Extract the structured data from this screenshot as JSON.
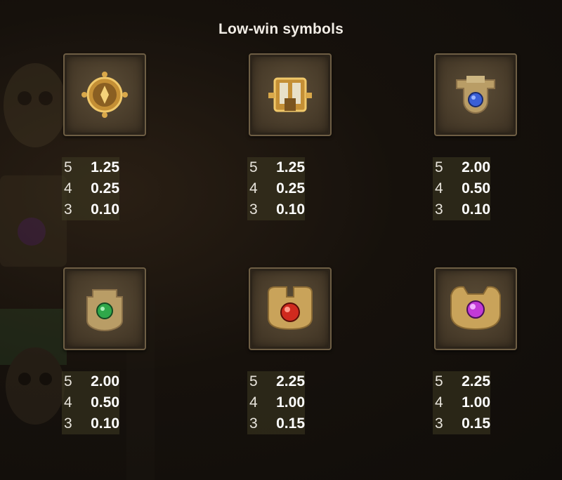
{
  "title": "Low-win symbols",
  "symbols": [
    {
      "icon": "golden-disc-icon",
      "pays": [
        {
          "count": "5",
          "value": "1.25"
        },
        {
          "count": "4",
          "value": "0.25"
        },
        {
          "count": "3",
          "value": "0.10"
        }
      ]
    },
    {
      "icon": "golden-door-icon",
      "pays": [
        {
          "count": "5",
          "value": "1.25"
        },
        {
          "count": "4",
          "value": "0.25"
        },
        {
          "count": "3",
          "value": "0.10"
        }
      ]
    },
    {
      "icon": "blue-gem-totem-icon",
      "pays": [
        {
          "count": "5",
          "value": "2.00"
        },
        {
          "count": "4",
          "value": "0.50"
        },
        {
          "count": "3",
          "value": "0.10"
        }
      ]
    },
    {
      "icon": "green-gem-totem-icon",
      "pays": [
        {
          "count": "5",
          "value": "2.00"
        },
        {
          "count": "4",
          "value": "0.50"
        },
        {
          "count": "3",
          "value": "0.10"
        }
      ]
    },
    {
      "icon": "red-gem-totem-icon",
      "pays": [
        {
          "count": "5",
          "value": "2.25"
        },
        {
          "count": "4",
          "value": "1.00"
        },
        {
          "count": "3",
          "value": "0.15"
        }
      ]
    },
    {
      "icon": "purple-gem-totem-icon",
      "pays": [
        {
          "count": "5",
          "value": "2.25"
        },
        {
          "count": "4",
          "value": "1.00"
        },
        {
          "count": "3",
          "value": "0.15"
        }
      ]
    }
  ],
  "colors": {
    "gold": "#d9a84a",
    "blue_gem": "#3a5fd6",
    "green_gem": "#2fa84a",
    "red_gem": "#d02a1e",
    "purple_gem": "#c23ad6"
  }
}
